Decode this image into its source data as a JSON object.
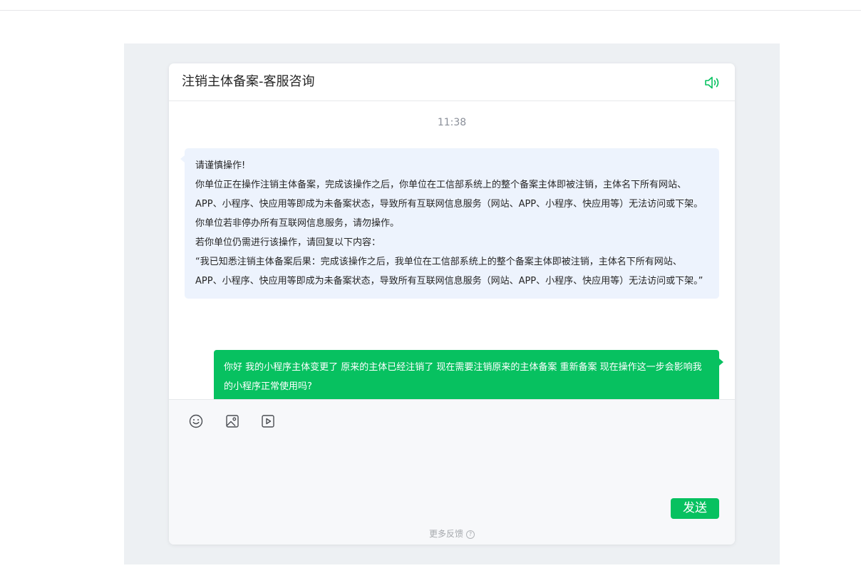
{
  "chat": {
    "title": "注销主体备案-客服咨询",
    "timestamp": "11:38",
    "messages": [
      {
        "direction": "incoming",
        "lines": [
          "请谨慎操作!",
          "你单位正在操作注销主体备案，完成该操作之后，你单位在工信部系统上的整个备案主体即被注销，主体名下所有网站、APP、小程序、快应用等即成为未备案状态，导致所有互联网信息服务（网站、APP、小程序、快应用等）无法访问或下架。",
          "你单位若非停办所有互联网信息服务，请勿操作。",
          "若你单位仍需进行该操作，请回复以下内容：",
          "“我已知悉注销主体备案后果：完成该操作之后，我单位在工信部系统上的整个备案主体即被注销，主体名下所有网站、APP、小程序、快应用等即成为未备案状态，导致所有互联网信息服务（网站、APP、小程序、快应用等）无法访问或下架。”"
        ]
      },
      {
        "direction": "outgoing",
        "text": "你好 我的小程序主体变更了 原来的主体已经注销了 现在需要注销原来的主体备案 重新备案 现在操作这一步会影响我的小程序正常使用吗?"
      }
    ]
  },
  "composer": {
    "tools": [
      "emoji-icon",
      "image-icon",
      "video-icon"
    ],
    "send_label": "发送",
    "feedback_label": "更多反馈",
    "help_glyph": "?"
  },
  "colors": {
    "accent": "#07c160",
    "incoming_bubble": "#edf3fd",
    "backdrop": "#edf0f3",
    "composer_bg": "#f7f8fa"
  }
}
